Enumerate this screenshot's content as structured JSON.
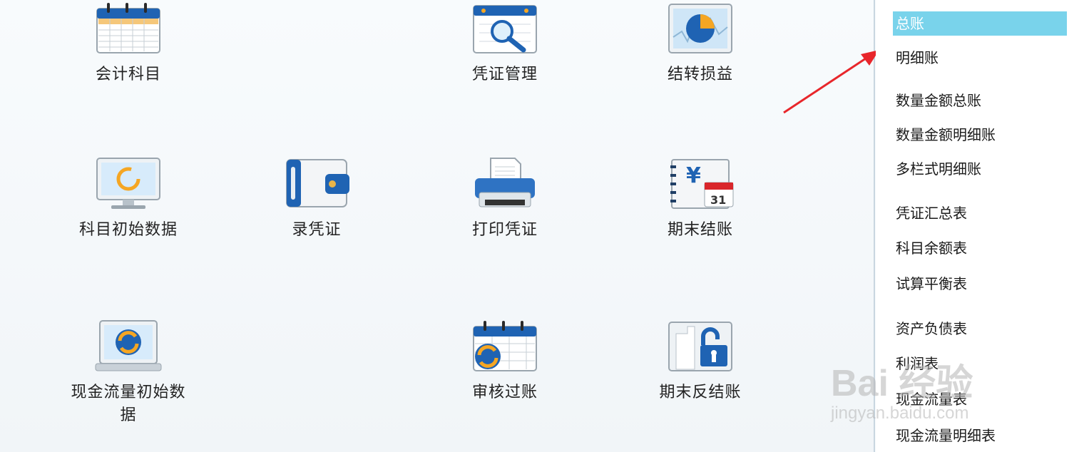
{
  "tiles": {
    "accounts": "会计科目",
    "voucher_mgmt": "凭证管理",
    "carry_forward": "结转损益",
    "initial_data": "科目初始数据",
    "enter_voucher": "录凭证",
    "print_voucher": "打印凭证",
    "period_close": "期末结账",
    "cashflow_initial": "现金流量初始数据",
    "audit_post": "审核过账",
    "reverse_close": "期末反结账"
  },
  "sidebar": {
    "items": [
      {
        "label": "总账",
        "selected": true
      },
      {
        "label": "明细账"
      },
      {
        "label": "数量金额总账"
      },
      {
        "label": "数量金额明细账"
      },
      {
        "label": "多栏式明细账"
      },
      {
        "label": "凭证汇总表"
      },
      {
        "label": "科目余额表"
      },
      {
        "label": "试算平衡表"
      },
      {
        "label": "资产负债表"
      },
      {
        "label": "利润表"
      },
      {
        "label": "现金流量表"
      },
      {
        "label": "现金流量明细表"
      }
    ]
  },
  "watermark": {
    "brand": "Bai 经验",
    "url": "jingyan.baidu.com"
  },
  "colors": {
    "selected_bg": "#79d3eb",
    "arrow": "#e8262b"
  }
}
